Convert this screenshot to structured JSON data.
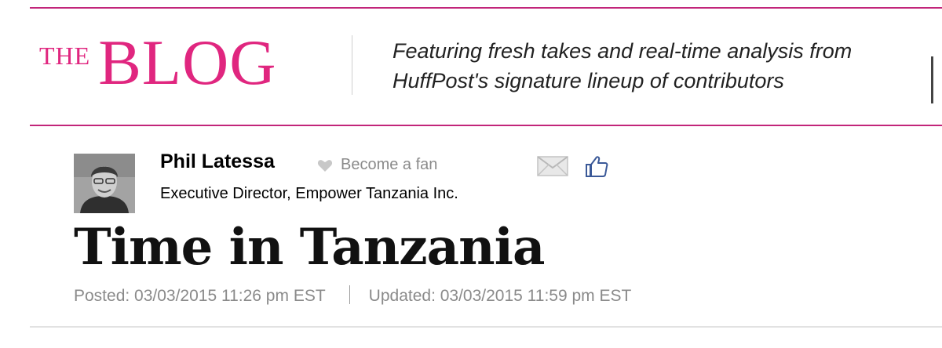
{
  "header": {
    "logo_the": "THE",
    "logo_blog": "BLOG",
    "tagline_line1": "Featuring fresh takes and real-time analysis from",
    "tagline_line2": "HuffPost's signature lineup of contributors"
  },
  "author": {
    "name": "Phil Latessa",
    "fan_label": "Become a fan",
    "title": "Executive Director, Empower Tanzania Inc."
  },
  "icons": {
    "fan": "heart-icon",
    "email": "mail-icon",
    "like": "facebook-like-icon"
  },
  "article": {
    "headline": "Time in Tanzania",
    "posted": "Posted: 03/03/2015 11:26 pm EST",
    "updated": "Updated: 03/03/2015 11:59 pm EST"
  },
  "colors": {
    "brand_pink": "#e0267f",
    "rule_pink": "#c2257a",
    "facebook_blue": "#3b5998"
  }
}
